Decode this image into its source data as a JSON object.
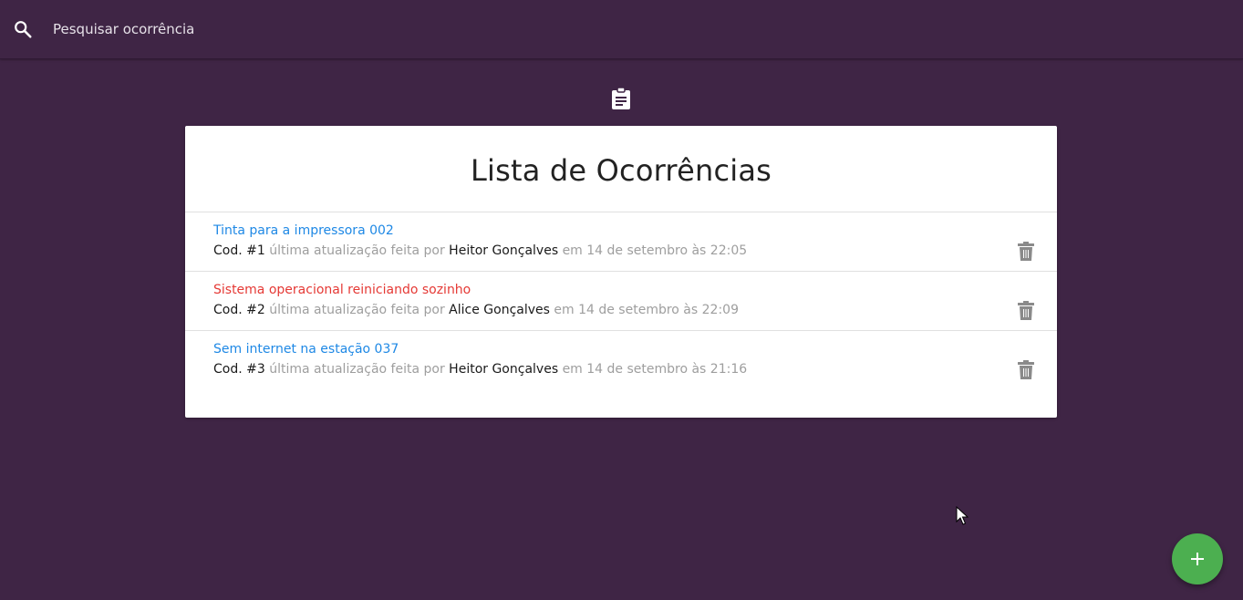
{
  "search": {
    "placeholder": "Pesquisar ocorrência",
    "icon": "search-icon"
  },
  "header_icon": "clipboard-icon",
  "card": {
    "title": "Lista de Ocorrências"
  },
  "items": [
    {
      "title": "Tinta para a impressora 002",
      "title_color": "#1e88e5",
      "code_label": "Cod. #1",
      "updated_text": "última atualização feita por",
      "author": "Heitor Gonçalves",
      "date_text": "em 14 de setembro às 22:05"
    },
    {
      "title": "Sistema operacional reiniciando sozinho",
      "title_color": "#e53935",
      "code_label": "Cod. #2",
      "updated_text": "última atualização feita por",
      "author": "Alice Gonçalves",
      "date_text": "em 14 de setembro às 22:09"
    },
    {
      "title": "Sem internet na estação 037",
      "title_color": "#1e88e5",
      "code_label": "Cod. #3",
      "updated_text": "última atualização feita por",
      "author": "Heitor Gonçalves",
      "date_text": "em 14 de setembro às 21:16"
    }
  ],
  "fab": {
    "icon": "plus-icon",
    "color": "#4caf50"
  },
  "colors": {
    "background": "#3f2545",
    "link_blue": "#1e88e5",
    "alert_red": "#e53935",
    "muted": "#9e9e9e"
  }
}
